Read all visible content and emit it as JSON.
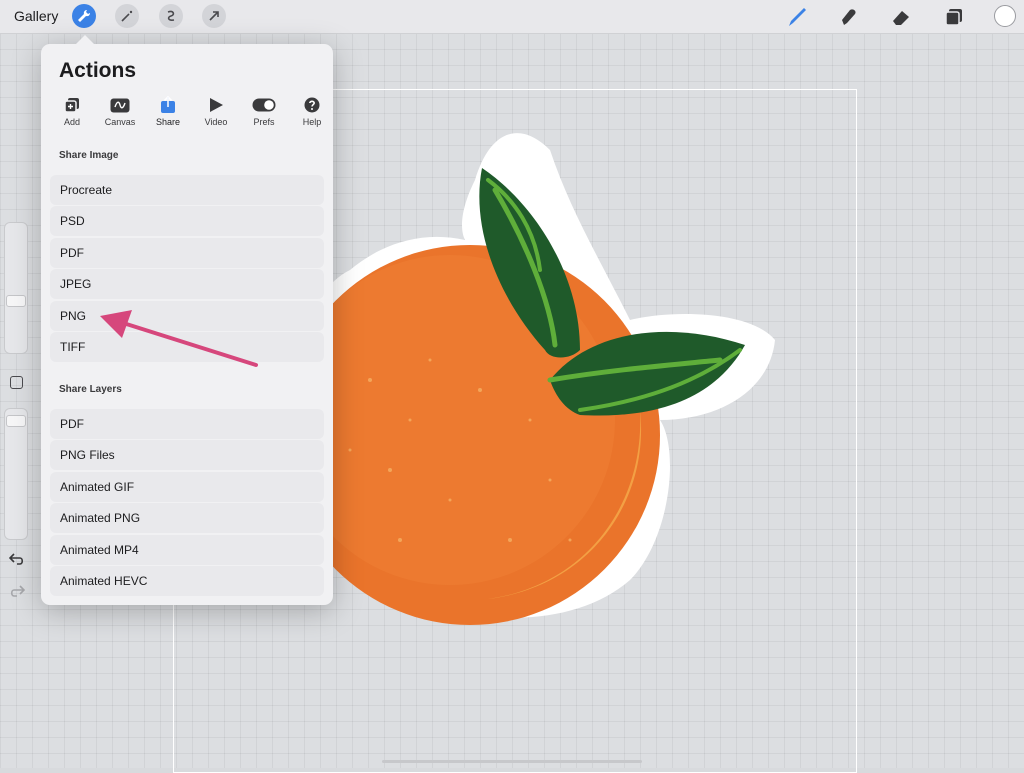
{
  "topbar": {
    "gallery_label": "Gallery",
    "tools_left": [
      "wrench-icon",
      "magic-wand-icon",
      "selection-icon",
      "transform-icon"
    ],
    "tools_right": [
      "brush-icon",
      "smudge-icon",
      "eraser-icon",
      "layers-icon"
    ],
    "current_color": "#ffffff"
  },
  "actions": {
    "title": "Actions",
    "tabs": [
      {
        "label": "Add",
        "icon": "add-icon"
      },
      {
        "label": "Canvas",
        "icon": "canvas-icon"
      },
      {
        "label": "Share",
        "icon": "share-icon",
        "active": true
      },
      {
        "label": "Video",
        "icon": "play-icon"
      },
      {
        "label": "Prefs",
        "icon": "toggle-icon"
      },
      {
        "label": "Help",
        "icon": "help-icon"
      }
    ],
    "share_image": {
      "heading": "Share Image",
      "items": [
        "Procreate",
        "PSD",
        "PDF",
        "JPEG",
        "PNG",
        "TIFF"
      ]
    },
    "share_layers": {
      "heading": "Share Layers",
      "items": [
        "PDF",
        "PNG Files",
        "Animated GIF",
        "Animated PNG",
        "Animated MP4",
        "Animated HEVC"
      ]
    }
  },
  "colors": {
    "accent": "#3b82e6",
    "annotation_arrow": "#d6477c",
    "orange": "#e9732a",
    "leaf_dark": "#1f5a2a",
    "leaf_light": "#5fae3a"
  }
}
